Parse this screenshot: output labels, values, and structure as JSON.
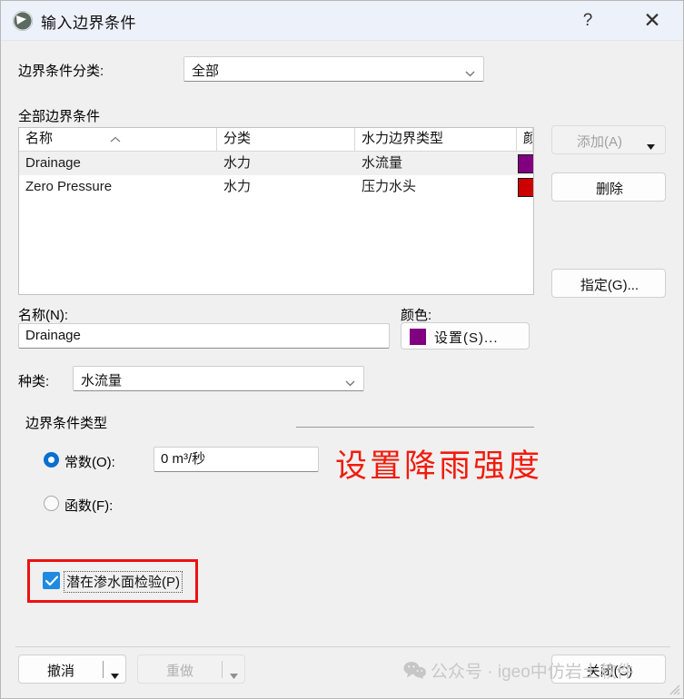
{
  "window": {
    "title": "输入边界条件",
    "help_icon": "question-mark-icon",
    "close_icon": "close-x-icon",
    "app_icon": "app-logo-icon"
  },
  "filter": {
    "label": "边界条件分类:",
    "value": "全部",
    "chevron_icon": "chevron-down-icon"
  },
  "list": {
    "caption": "全部边界条件",
    "sort_icon": "sort-ascending-caret-icon",
    "columns": [
      "名称",
      "分类",
      "水力边界类型",
      "颜"
    ],
    "rows": [
      {
        "name": "Drainage",
        "category": "水力",
        "type": "水流量",
        "color": "#800080",
        "selected": true
      },
      {
        "name": "Zero Pressure",
        "category": "水力",
        "type": "压力水头",
        "color": "#cc0000",
        "selected": false
      }
    ]
  },
  "side_buttons": {
    "add": {
      "label": "添加(A)",
      "accel": "A",
      "enabled": false,
      "chevron_icon": "dropdown-arrow-icon"
    },
    "delete": {
      "label": "删除",
      "enabled": false
    },
    "assign": {
      "label": "指定(G)...",
      "accel": "G",
      "enabled": true
    }
  },
  "name_field": {
    "label": "名称(N):",
    "accel": "N",
    "value": "Drainage"
  },
  "color_field": {
    "label": "颜色:",
    "button_label": "设置(S)...",
    "accel": "S",
    "swatch": "#800080"
  },
  "kind_field": {
    "label": "种类:",
    "value": "水流量",
    "chevron_icon": "chevron-down-icon"
  },
  "bc_type_group": {
    "legend": "边界条件类型",
    "constant": {
      "label": "常数(O):",
      "accel": "O",
      "selected": true,
      "value": "0 m³/秒"
    },
    "function": {
      "label": "函数(F):",
      "accel": "F",
      "selected": false
    }
  },
  "seepage_check": {
    "label": "潜在渗水面检验(P)",
    "accel": "P",
    "checked": true,
    "check_icon": "checkmark-icon"
  },
  "annotation": {
    "red_text": "设置降雨强度",
    "color": "#f11b0c"
  },
  "footer": {
    "undo": {
      "label": "撤消",
      "enabled": true,
      "chevron_icon": "dropdown-arrow-icon"
    },
    "redo": {
      "label": "重做",
      "enabled": false,
      "chevron_icon": "dropdown-arrow-icon"
    },
    "close": {
      "label": "关闭(C)",
      "accel": "C"
    },
    "watermark": "公众号 · igeo中仿岩土软件",
    "watermark_icon": "wechat-icon",
    "resize_grip_icon": "resize-grip-icon"
  }
}
